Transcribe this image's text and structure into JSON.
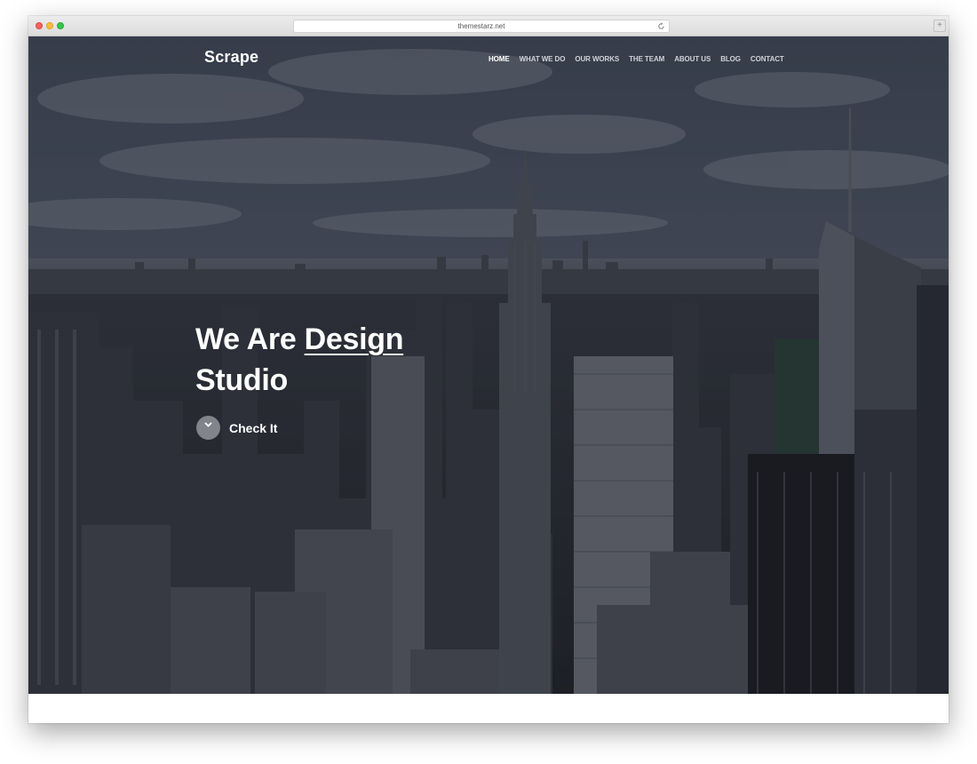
{
  "browser": {
    "url": "themestarz.net"
  },
  "site": {
    "logo": "Scrape",
    "nav": [
      {
        "label": "HOME",
        "active": true
      },
      {
        "label": "WHAT WE DO",
        "active": false
      },
      {
        "label": "OUR WORKS",
        "active": false
      },
      {
        "label": "THE TEAM",
        "active": false
      },
      {
        "label": "ABOUT US",
        "active": false
      },
      {
        "label": "BLOG",
        "active": false
      },
      {
        "label": "CONTACT",
        "active": false
      }
    ]
  },
  "hero": {
    "headline_line1_prefix": "We Are ",
    "headline_line1_underlined": "Design",
    "headline_line2": "Studio",
    "cta_label": "Check It"
  },
  "icons": {
    "cta": "chevron-down-icon",
    "reload": "reload-icon",
    "new_tab": "plus-icon"
  },
  "colors": {
    "text_primary": "#ffffff",
    "nav_inactive": "#cfd2d8"
  }
}
